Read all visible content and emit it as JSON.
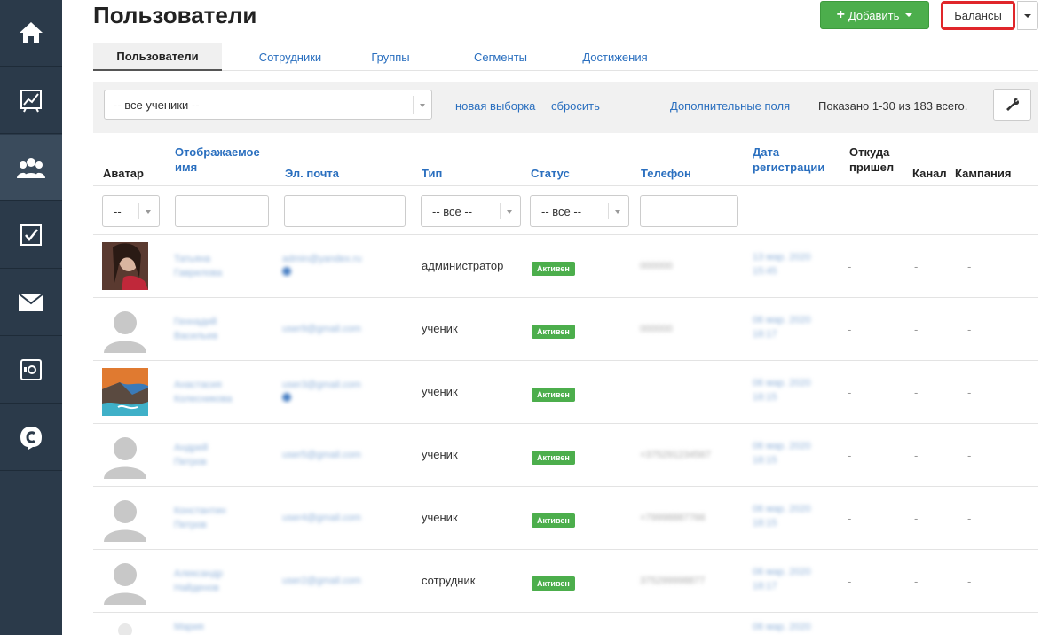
{
  "header": {
    "title": "Пользователи",
    "add_button": "Добавить",
    "balances_button": "Балансы"
  },
  "tabs": [
    {
      "label": "Пользователи",
      "active": true
    },
    {
      "label": "Сотрудники"
    },
    {
      "label": "Группы"
    },
    {
      "label": "Сегменты"
    },
    {
      "label": "Достижения"
    }
  ],
  "filter_bar": {
    "selection_value": "-- все ученики --",
    "new_selection": "новая выборка",
    "reset": "сбросить",
    "extra_fields": "Дополнительные поля",
    "shown": "Показано 1-30 из 183 всего."
  },
  "columns": {
    "avatar": "Аватар",
    "display_name_1": "Отображаемое",
    "display_name_2": "имя",
    "email": "Эл. почта",
    "type": "Тип",
    "status": "Статус",
    "phone": "Телефон",
    "reg_date_1": "Дата",
    "reg_date_2": "регистрации",
    "source_1": "Откуда",
    "source_2": "пришел",
    "channel": "Канал",
    "campaign": "Кампания"
  },
  "filters": {
    "avatar_select": "--",
    "type_select": "-- все --",
    "status_select": "-- все --"
  },
  "rows": [
    {
      "name1": "Татьяна",
      "name2": "Гаврилова",
      "email": "admin@yandex.ru",
      "type": "администратор",
      "status": "Активен",
      "phone": "000000",
      "date1": "13 мар. 2020",
      "date2": "15:45",
      "source": "-",
      "channel": "-",
      "campaign": "-"
    },
    {
      "name1": "Геннадий",
      "name2": "Васильев",
      "email": "user9@gmail.com",
      "type": "ученик",
      "status": "Активен",
      "phone": "000000",
      "date1": "06 мар. 2020",
      "date2": "18:17",
      "source": "-",
      "channel": "-",
      "campaign": "-"
    },
    {
      "name1": "Анастасия",
      "name2": "Колесникова",
      "email": "user3@gmail.com",
      "type": "ученик",
      "status": "Активен",
      "phone": "",
      "date1": "06 мар. 2020",
      "date2": "18:15",
      "source": "-",
      "channel": "-",
      "campaign": "-"
    },
    {
      "name1": "Андрей",
      "name2": "Петров",
      "email": "user5@gmail.com",
      "type": "ученик",
      "status": "Активен",
      "phone": "+375291234567",
      "date1": "06 мар. 2020",
      "date2": "18:15",
      "source": "-",
      "channel": "-",
      "campaign": "-"
    },
    {
      "name1": "Константин",
      "name2": "Петров",
      "email": "user4@gmail.com",
      "type": "ученик",
      "status": "Активен",
      "phone": "+79998887766",
      "date1": "06 мар. 2020",
      "date2": "18:15",
      "source": "-",
      "channel": "-",
      "campaign": "-"
    },
    {
      "name1": "Александр",
      "name2": "Найденов",
      "email": "user2@gmail.com",
      "type": "сотрудник",
      "status": "Активен",
      "phone": "375299998877",
      "date1": "06 мар. 2020",
      "date2": "18:17",
      "source": "-",
      "channel": "-",
      "campaign": "-"
    },
    {
      "name1": "Мария",
      "name2": "",
      "email": "",
      "type": "",
      "status": "",
      "phone": "",
      "date1": "06 мар. 2020",
      "date2": "",
      "source": "",
      "channel": "",
      "campaign": ""
    }
  ],
  "colors": {
    "sidebar": "#2b3a4a",
    "link": "#2a6fbf",
    "success": "#4cae4c",
    "highlight": "#e0262a"
  },
  "icons": [
    "home-icon",
    "chart-icon",
    "users-icon",
    "tasks-icon",
    "mail-icon",
    "safe-icon",
    "chat-logo-icon",
    "wrench-icon"
  ]
}
